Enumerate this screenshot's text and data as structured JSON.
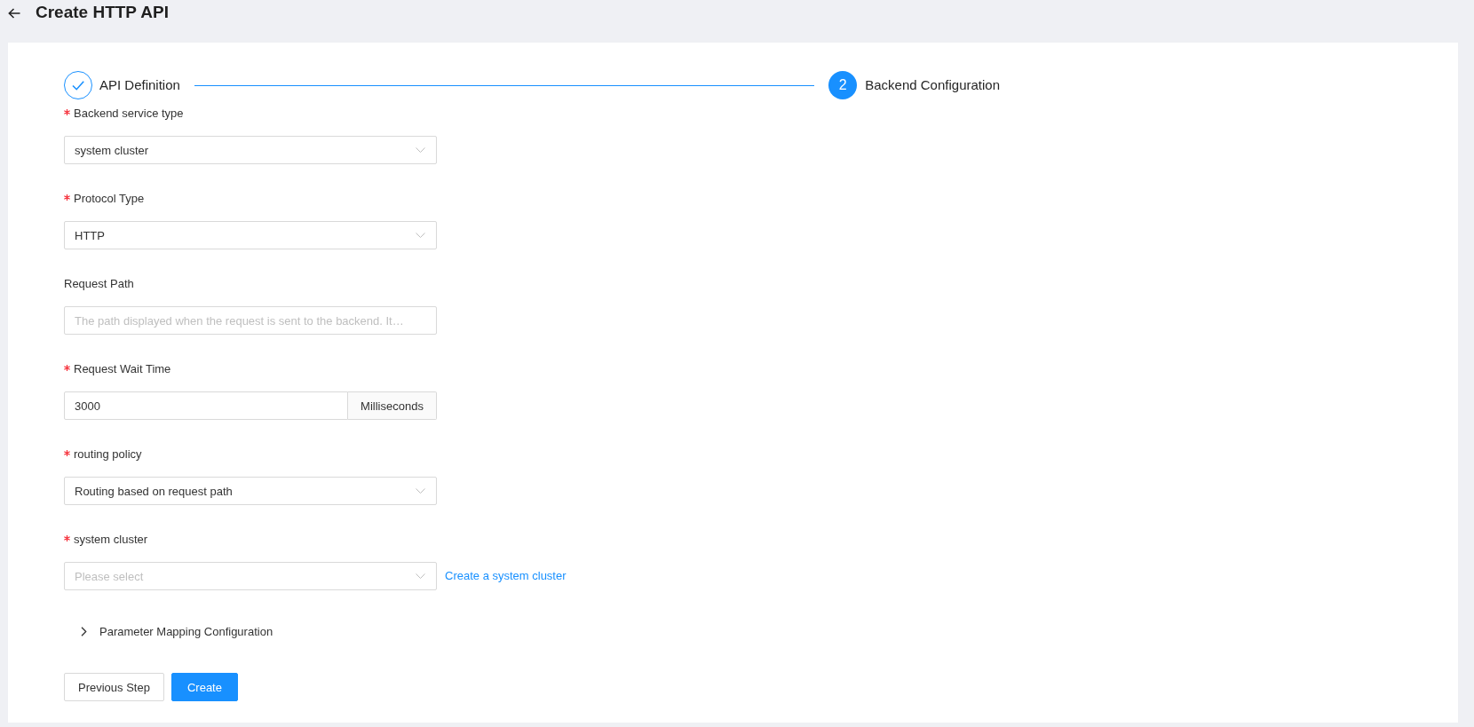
{
  "header": {
    "title": "Create HTTP API"
  },
  "steps": [
    {
      "done": true,
      "selected": false,
      "label": "API Definition"
    },
    {
      "done": false,
      "selected": true,
      "number": "2",
      "label": "Backend Configuration"
    }
  ],
  "form": {
    "fields": [
      {
        "kind": "select",
        "required": true,
        "label": "Backend service type",
        "value": "system cluster"
      },
      {
        "kind": "select",
        "required": true,
        "label": "Protocol Type",
        "value": "HTTP"
      },
      {
        "kind": "input",
        "required": false,
        "label": "Request Path",
        "placeholder": "The path displayed when the request is sent to the backend. It…"
      },
      {
        "kind": "input_addon",
        "required": true,
        "label": "Request Wait Time",
        "value": "3000",
        "addon": "Milliseconds"
      },
      {
        "kind": "select",
        "required": true,
        "label": "routing policy",
        "value": "Routing based on request path"
      },
      {
        "kind": "select",
        "required": true,
        "label": "system cluster",
        "placeholder": "Please select",
        "link": "Create a system cluster"
      }
    ],
    "collapse": {
      "label": "Parameter Mapping Configuration",
      "expanded": false
    }
  },
  "actions": [
    {
      "kind": "default",
      "label": "Previous Step"
    },
    {
      "kind": "primary",
      "label": "Create"
    }
  ]
}
